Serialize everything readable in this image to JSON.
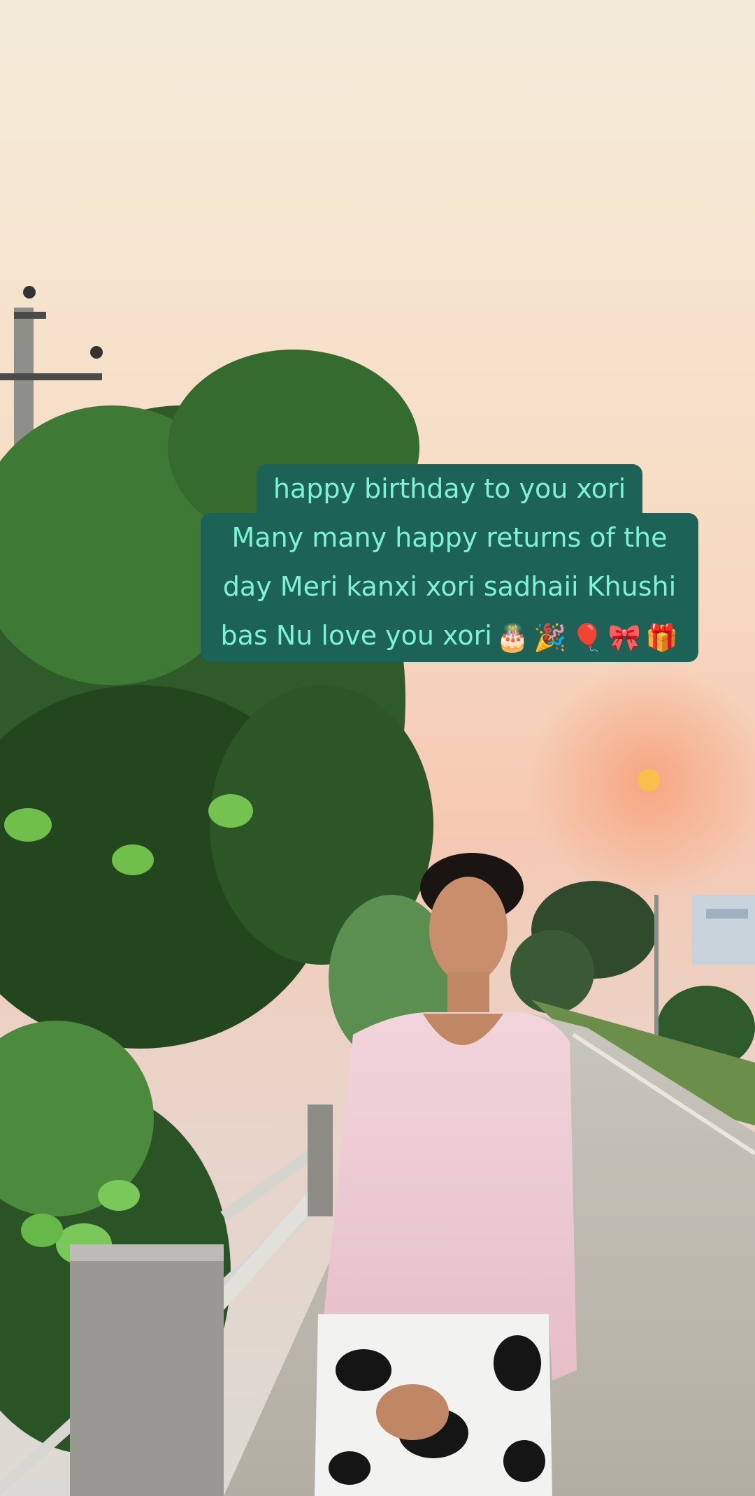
{
  "caption": {
    "lines": [
      "happy birthday to you xori",
      "Many many happy returns of the",
      "day Meri kanxi xori sadhaii Khushi",
      "bas Nu love you xori"
    ],
    "emojis": [
      "🎂",
      "🎉",
      "🎈",
      "🎀",
      "🎁"
    ],
    "background_color": "#1c6256",
    "text_color": "#7ff2d6"
  }
}
